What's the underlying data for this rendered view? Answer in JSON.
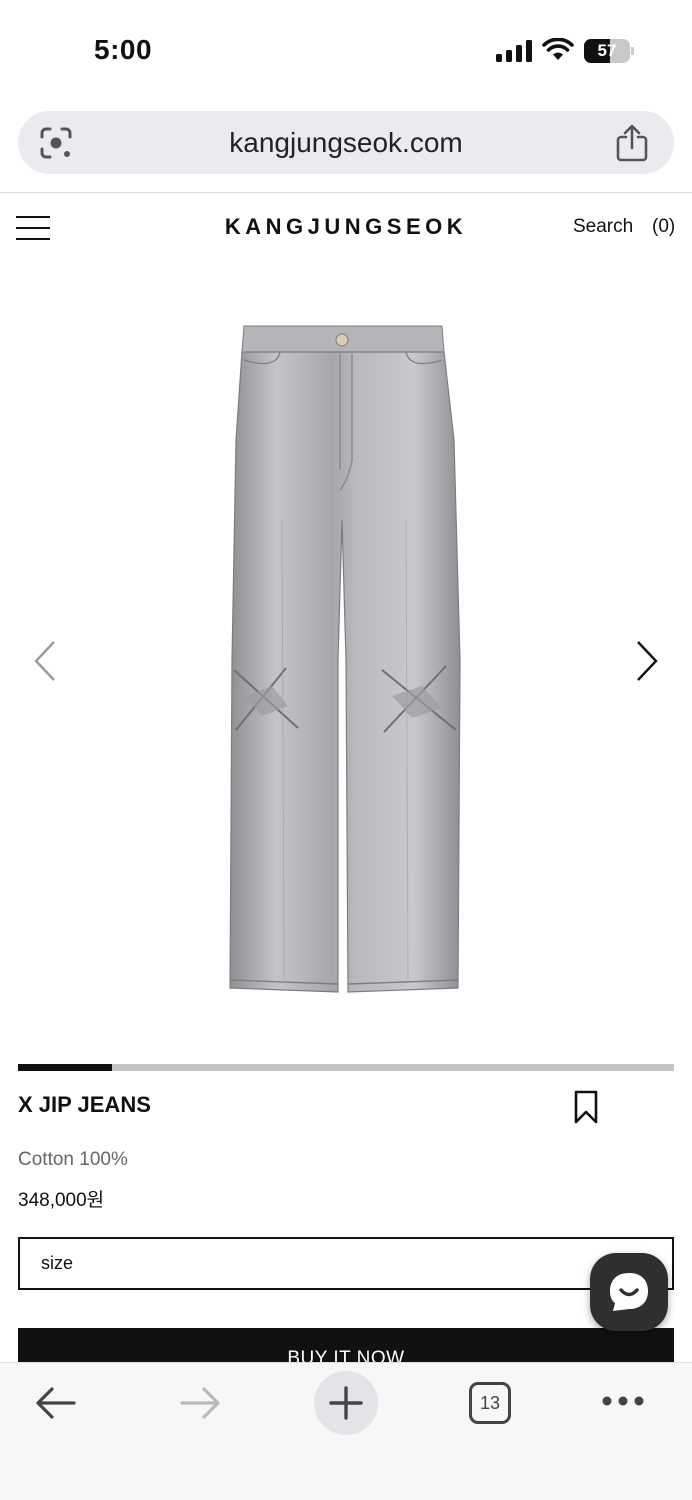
{
  "status_bar": {
    "time": "5:00",
    "battery_level": "57",
    "icons": [
      "cellular-signal-icon",
      "wifi-icon",
      "battery-icon"
    ]
  },
  "browser": {
    "url": "kangjungseok.com",
    "icons": [
      "google-lens-icon",
      "share-icon"
    ]
  },
  "site_header": {
    "brand": "KANGJUNGSEOK",
    "search_label": "Search",
    "cart_count": "(0)",
    "icons": [
      "hamburger-menu-icon"
    ]
  },
  "gallery": {
    "progress_fraction": 0.143,
    "icons": [
      "chevron-left-icon",
      "chevron-right-icon"
    ]
  },
  "product": {
    "name": "X JIP JEANS",
    "material": "Cotton 100%",
    "price": "348,000원",
    "size_placeholder": "size",
    "buy_label": "BUY IT NOW"
  },
  "toolbar": {
    "tab_count": "13",
    "icons": [
      "back-arrow-icon",
      "forward-arrow-icon",
      "plus-icon",
      "tabs-icon",
      "more-icon"
    ]
  },
  "colors": {
    "accent": "#111111",
    "url_bar_bg": "#e9ebee",
    "chat_bg": "#2f2f2f"
  }
}
